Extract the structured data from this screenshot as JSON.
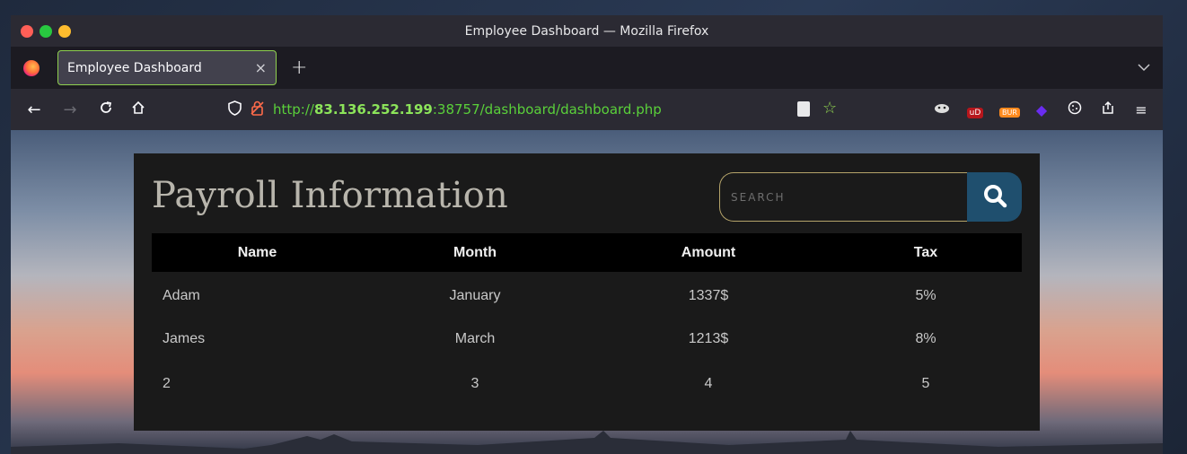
{
  "window": {
    "title": "Employee Dashboard — Mozilla Firefox"
  },
  "tab": {
    "label": "Employee Dashboard",
    "close": "×",
    "new_tab": "+",
    "list": "⌄"
  },
  "nav": {
    "back": "←",
    "forward": "→",
    "reload": "↻",
    "home": "⌂",
    "url_scheme": "http://",
    "url_host": "83.136.252.199",
    "url_rest": ":38757/dashboard/dashboard.php",
    "menu": "≡"
  },
  "page": {
    "title": "Payroll Information",
    "search_placeholder": "SEARCH",
    "table": {
      "headers": [
        "Name",
        "Month",
        "Amount",
        "Tax"
      ],
      "rows": [
        [
          "Adam",
          "January",
          "1337$",
          "5%"
        ],
        [
          "James",
          "March",
          "1213$",
          "8%"
        ],
        [
          "2",
          "3",
          "4",
          "5"
        ]
      ]
    }
  },
  "colors": {
    "accent_green": "#8fd14f",
    "search_button": "#1f4f6e",
    "panel_bg": "#1a1a1a",
    "title_color": "#b8b5ac"
  },
  "extensions": {
    "ublock_label": "uD",
    "burp_label": "BUR"
  }
}
